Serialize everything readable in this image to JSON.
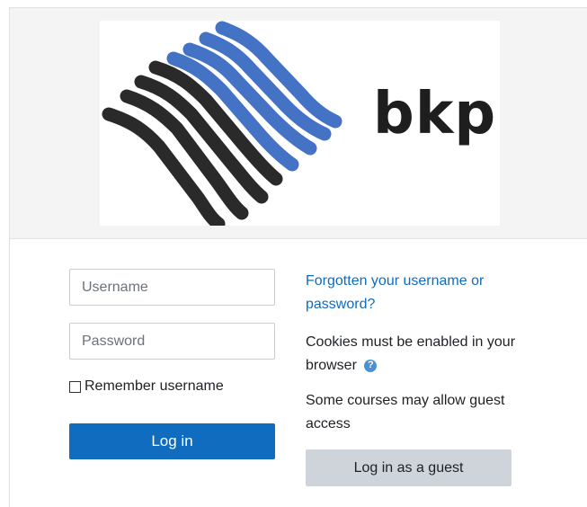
{
  "logo": {
    "text": "bkp",
    "colors": {
      "dark": "#2a2a2a",
      "blue": "#4472c4"
    }
  },
  "form": {
    "username_placeholder": "Username",
    "password_placeholder": "Password",
    "remember_label": "Remember username",
    "login_label": "Log in"
  },
  "side": {
    "forgot_link": "Forgotten your username or password?",
    "cookies_text": "Cookies must be enabled in your browser",
    "help_icon_glyph": "?",
    "guest_text": "Some courses may allow guest access",
    "guest_button": "Log in as a guest"
  },
  "colors": {
    "primary": "#0f6cbf",
    "secondary_button": "#ced4da",
    "link": "#0f6cbf"
  }
}
